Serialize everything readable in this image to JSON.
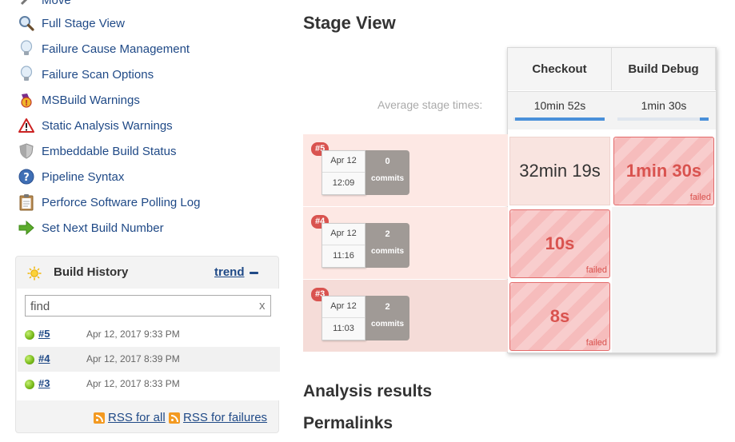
{
  "sidebar": {
    "items": [
      {
        "label": "Move",
        "icon": "move-icon"
      },
      {
        "label": "Full Stage View",
        "icon": "magnifier-icon"
      },
      {
        "label": "Failure Cause Management",
        "icon": "lightbulb-icon"
      },
      {
        "label": "Failure Scan Options",
        "icon": "lightbulb-icon"
      },
      {
        "label": "MSBuild Warnings",
        "icon": "msbuild-warning-icon"
      },
      {
        "label": "Static Analysis Warnings",
        "icon": "warning-triangle-icon"
      },
      {
        "label": "Embeddable Build Status",
        "icon": "shield-icon"
      },
      {
        "label": "Pipeline Syntax",
        "icon": "help-icon"
      },
      {
        "label": "Perforce Software Polling Log",
        "icon": "clipboard-icon"
      },
      {
        "label": "Set Next Build Number",
        "icon": "green-arrow-icon"
      }
    ]
  },
  "build_history": {
    "title": "Build History",
    "trend_label": "trend",
    "search_value": "find",
    "clear_label": "x",
    "builds": [
      {
        "number": "#5",
        "date": "Apr 12, 2017 9:33 PM",
        "status_color": "#7cbd1e"
      },
      {
        "number": "#4",
        "date": "Apr 12, 2017 8:39 PM",
        "status_color": "#7cbd1e"
      },
      {
        "number": "#3",
        "date": "Apr 12, 2017 8:33 PM",
        "status_color": "#7cbd1e"
      }
    ],
    "rss_all": "RSS for all",
    "rss_failures": "RSS for failures"
  },
  "stage_view": {
    "title": "Stage View",
    "average_label": "Average stage times:",
    "stages": [
      {
        "name": "Checkout",
        "average": "10min 52s",
        "bar_fill": 0.98
      },
      {
        "name": "Build Debug",
        "average": "1min 30s",
        "bar_fill": 0.1
      }
    ],
    "runs": [
      {
        "badge": "#5",
        "date": "Apr 12",
        "time": "12:09",
        "commits_count": "0",
        "commits_label": "commits",
        "cells": [
          {
            "value": "32min 19s",
            "status": "",
            "failed": false
          },
          {
            "value": "1min 30s",
            "status": "failed",
            "failed": true
          }
        ]
      },
      {
        "badge": "#4",
        "date": "Apr 12",
        "time": "11:16",
        "commits_count": "2",
        "commits_label": "commits",
        "cells": [
          {
            "value": "10s",
            "status": "failed",
            "failed": true
          }
        ]
      },
      {
        "badge": "#3",
        "date": "Apr 12",
        "time": "11:03",
        "commits_count": "2",
        "commits_label": "commits",
        "cells": [
          {
            "value": "8s",
            "status": "failed",
            "failed": true
          }
        ]
      }
    ]
  },
  "sections": {
    "analysis_results": "Analysis results",
    "permalinks": "Permalinks"
  },
  "colors": {
    "link": "#204a87",
    "failure": "#d9534f",
    "success_ball": "#7cbd1e",
    "progress": "#4a90d9"
  }
}
